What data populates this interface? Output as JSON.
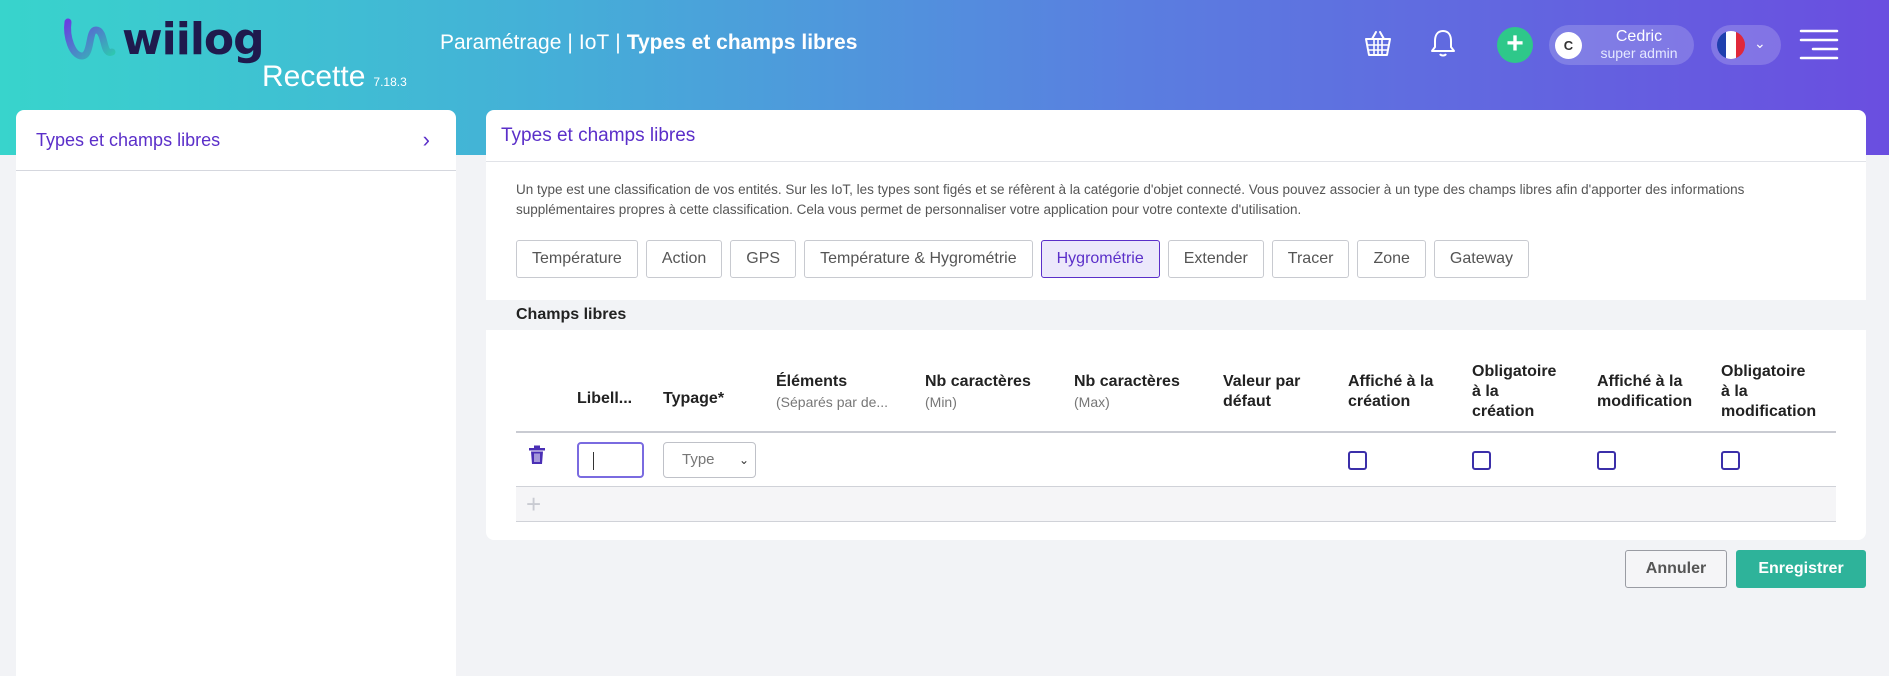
{
  "header": {
    "logo_text": "wiilog",
    "environment": "Recette",
    "version": "7.18.3",
    "breadcrumb": {
      "part1": "Paramétrage",
      "part2": "IoT",
      "current": "Types et champs libres",
      "separator": "|"
    },
    "icons": {
      "basket": "basket-icon",
      "bell": "bell-icon",
      "menu": "menu-icon"
    },
    "add_label": "+",
    "user": {
      "initial": "C",
      "name": "Cedric",
      "role": "super admin"
    },
    "language_flag": "fr-flag-icon"
  },
  "sidebar": {
    "items": [
      {
        "label": "Types et champs libres"
      }
    ]
  },
  "main": {
    "title": "Types et champs libres",
    "description": "Un type est une classification de vos entités. Sur les IoT, les types sont figés et se réfèrent à la catégorie d'objet connecté. Vous pouvez associer à un type des champs libres afin d'apporter des informations supplémentaires propres à cette classification. Cela vous permet de personnaliser votre application pour votre contexte d'utilisation.",
    "types": [
      "Température",
      "Action",
      "GPS",
      "Température & Hygrométrie",
      "Hygrométrie",
      "Extender",
      "Tracer",
      "Zone",
      "Gateway"
    ],
    "active_type": "Hygrométrie",
    "section_title": "Champs libres",
    "columns": {
      "libelle": "Libell...",
      "typage": "Typage*",
      "elements": "Éléments",
      "elements_sub": "(Séparés par de...",
      "nb_min": "Nb caractères",
      "nb_min_sub": "(Min)",
      "nb_max": "Nb caractères",
      "nb_max_sub": "(Max)",
      "default_l1": "Valeur par",
      "default_l2": "défaut",
      "shown_creation_l1": "Affiché à la",
      "shown_creation_l2": "création",
      "req_creation_l1": "Obligatoire",
      "req_creation_l2": "à la",
      "req_creation_l3": "création",
      "shown_modif_l1": "Affiché à la",
      "shown_modif_l2": "modification",
      "req_modif_l1": "Obligatoire",
      "req_modif_l2": "à la",
      "req_modif_l3": "modification"
    },
    "row": {
      "libelle_value": "",
      "type_select": "Type"
    },
    "add_row_label": "+",
    "colors": {
      "accent": "#5b2fc9",
      "save": "#2eb39a"
    }
  },
  "footer": {
    "cancel_label": "Annuler",
    "save_label": "Enregistrer"
  }
}
